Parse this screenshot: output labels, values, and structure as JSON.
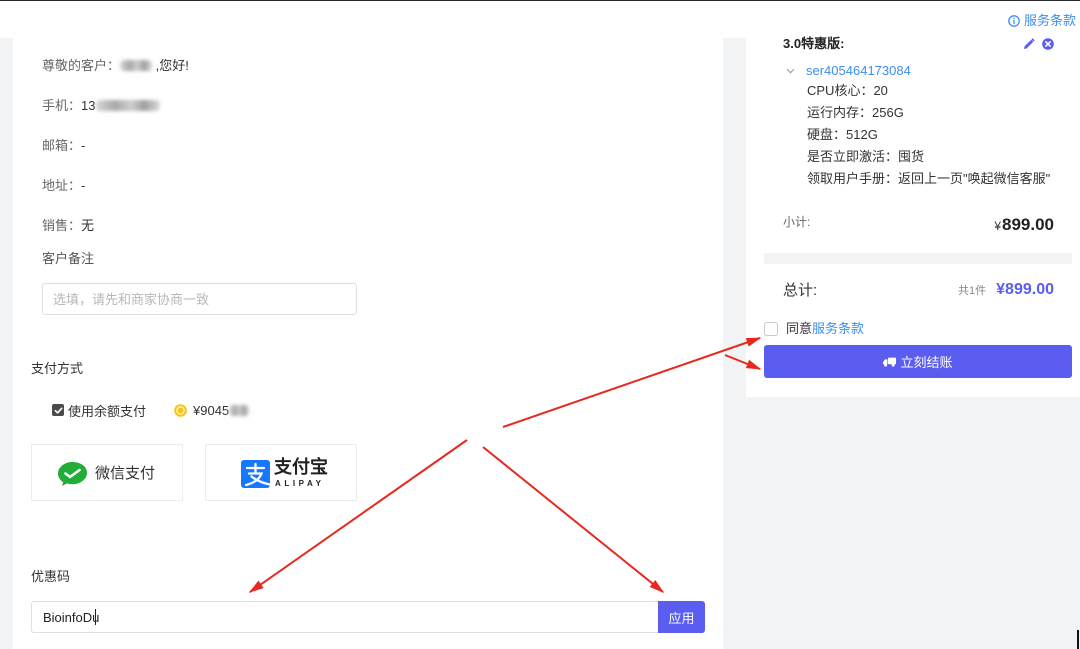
{
  "header": {
    "terms_icon": "info-circle-icon",
    "terms_label": "服务条款"
  },
  "customer": {
    "greeting_prefix": "尊敬的客户：",
    "greeting_suffix": " ,您好!",
    "phone_label": "手机：",
    "phone_visible": "13",
    "email_label": "邮箱：",
    "email_value": "-",
    "address_label": "地址：",
    "address_value": "-",
    "sales_label": "销售：",
    "sales_value": "无",
    "remark_label": "客户备注",
    "remark_placeholder": "选填，请先和商家协商一致"
  },
  "payment": {
    "title": "支付方式",
    "use_balance_checked": true,
    "use_balance_label": "使用余额支付",
    "balance_icon": "coin-icon",
    "balance_visible": "¥9045",
    "methods": [
      {
        "icon": "wechat-pay-logo",
        "label": "微信支付"
      },
      {
        "icon": "alipay-logo",
        "label": "支付宝",
        "sub_label": "ALIPAY"
      }
    ]
  },
  "coupon": {
    "title": "优惠码",
    "code": "BioinfoDu",
    "apply_label": "应用"
  },
  "order": {
    "product_title": "3.0特惠版:",
    "edit_icon": "pencil-icon",
    "remove_icon": "close-circle-icon",
    "toggle_icon": "chevron-down-icon",
    "item_id": "ser405464173084",
    "specs": [
      {
        "label": "CPU核心：",
        "value": "20"
      },
      {
        "label": "运行内存：",
        "value": "256G"
      },
      {
        "label": "硬盘：",
        "value": "512G"
      },
      {
        "label": "是否立即激活：",
        "value": "囤货"
      },
      {
        "label": "领取用户手册：",
        "value": "返回上一页\"唤起微信客服\""
      }
    ],
    "subtotal_label": "小计:",
    "subtotal_currency": "¥",
    "subtotal_amount": "899.00",
    "total_label": "总计:",
    "total_count": "共1件",
    "total_value": "¥899.00",
    "agree_checked": false,
    "agree_prefix": "同意",
    "agree_link": "服务条款",
    "checkout_icon": "truck-icon",
    "checkout_label": "立刻结账"
  },
  "colors": {
    "accent": "#5b5cf0",
    "link": "#3d8ef0",
    "annotation_arrow": "#e8281e",
    "wechat_green": "#22ac38",
    "alipay_blue": "#1677ff"
  }
}
